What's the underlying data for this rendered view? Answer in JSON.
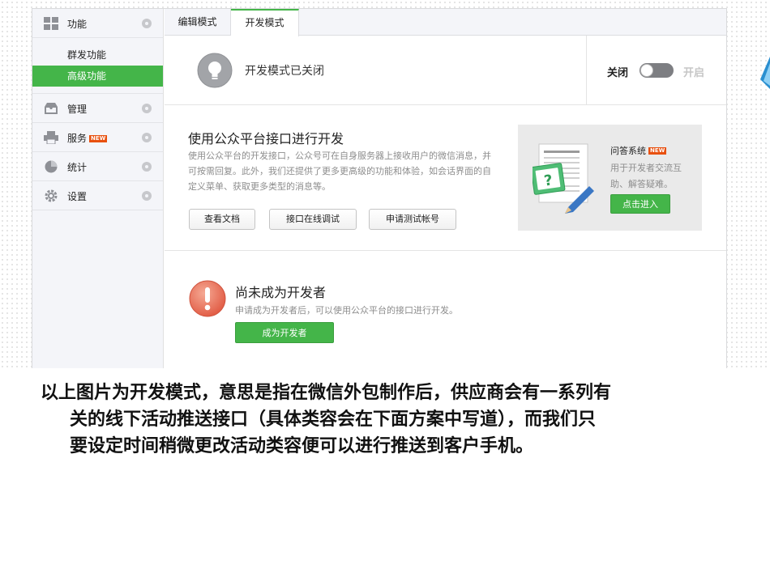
{
  "sidebar": {
    "groups": [
      {
        "label": "功能",
        "icon": "grid-icon"
      },
      {
        "label": "管理",
        "icon": "inbox-icon"
      },
      {
        "label": "服务",
        "icon": "printer-icon",
        "badge": "NEW"
      },
      {
        "label": "统计",
        "icon": "pie-chart-icon"
      },
      {
        "label": "设置",
        "icon": "gear-icon"
      }
    ],
    "sub_items": [
      {
        "label": "群发功能",
        "active": false
      },
      {
        "label": "高级功能",
        "active": true
      }
    ]
  },
  "tabs": [
    {
      "label": "编辑模式",
      "active": false
    },
    {
      "label": "开发模式",
      "active": true
    }
  ],
  "mode": {
    "status_text": "开发模式已关闭",
    "off_label": "关闭",
    "on_label": "开启",
    "enabled": false
  },
  "api": {
    "title": "使用公众平台接口进行开发",
    "description": "使用公众平台的开发接口，公众号可在自身服务器上接收用户的微信消息，并可按需回复。此外，我们还提供了更多更高级的功能和体验，如会话界面的自定义菜单、获取更多类型的消息等。",
    "buttons": [
      "查看文档",
      "接口在线调试",
      "申请测试帐号"
    ]
  },
  "qa": {
    "title": "问答系统",
    "badge": "NEW",
    "description": "用于开发者交流互助、解答疑难。",
    "button": "点击进入"
  },
  "developer": {
    "title": "尚未成为开发者",
    "description": "申请成为开发者后，可以使用公众平台的接口进行开发。",
    "button": "成为开发者"
  },
  "caption": {
    "line1": "以上图片为开发模式，意思是指在微信外包制作后，供应商会有一系列有",
    "line2": "关的线下活动推送接口（具体类容会在下面方案中写道），而我们只",
    "line3": "要设定时间稍微更改活动类容便可以进行推送到客户手机。"
  },
  "colors": {
    "accent_green": "#44b549",
    "warning_red": "#e4604a",
    "badge_orange": "#e8500f"
  }
}
